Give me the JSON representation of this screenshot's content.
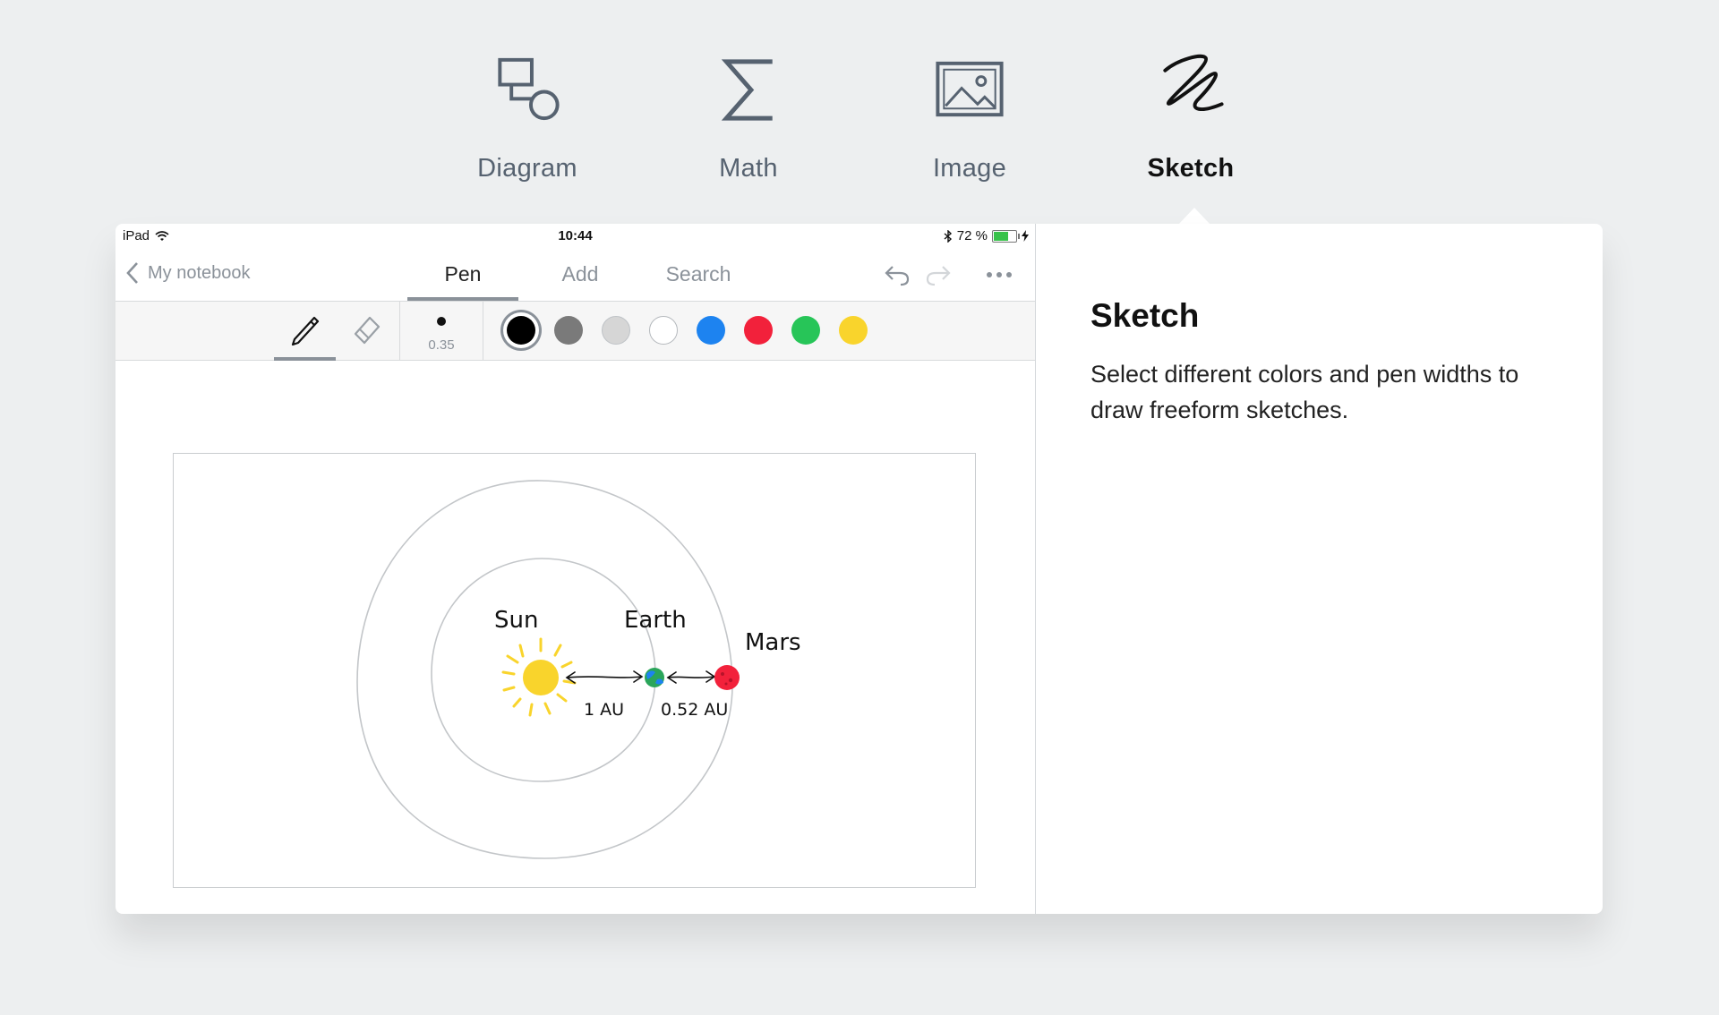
{
  "features": [
    {
      "label": "Diagram",
      "icon": "diagram-icon",
      "active": false
    },
    {
      "label": "Math",
      "icon": "sigma-icon",
      "active": false
    },
    {
      "label": "Image",
      "icon": "image-icon",
      "active": false
    },
    {
      "label": "Sketch",
      "icon": "sketch-icon",
      "active": true
    }
  ],
  "status_bar": {
    "device": "iPad",
    "time": "10:44",
    "battery": "72 %",
    "battery_level": 0.72
  },
  "nav": {
    "back_label": "My notebook",
    "tabs": [
      "Pen",
      "Add",
      "Search"
    ],
    "active_tab": "Pen"
  },
  "pen_toolbar": {
    "tools": [
      "pencil-icon",
      "eraser-icon"
    ],
    "pen_width": "0.35",
    "colors": [
      "#000000",
      "#7a7a7a",
      "#d6d6d6",
      "#ffffff",
      "#1d83f0",
      "#f2213b",
      "#27c558",
      "#f9d42c"
    ],
    "selected_color": "#000000"
  },
  "sketch": {
    "labels": {
      "sun": "Sun",
      "earth": "Earth",
      "mars": "Mars",
      "distance_sun_earth": "1 AU",
      "distance_earth_mars": "0.52 AU"
    },
    "colors": {
      "sun": "#f9d42c",
      "earth": "#2aa55a",
      "earth_water": "#1d83f0",
      "mars": "#f2213b"
    }
  },
  "description": {
    "title": "Sketch",
    "text": "Select different colors and pen widths to draw freeform sketches."
  }
}
